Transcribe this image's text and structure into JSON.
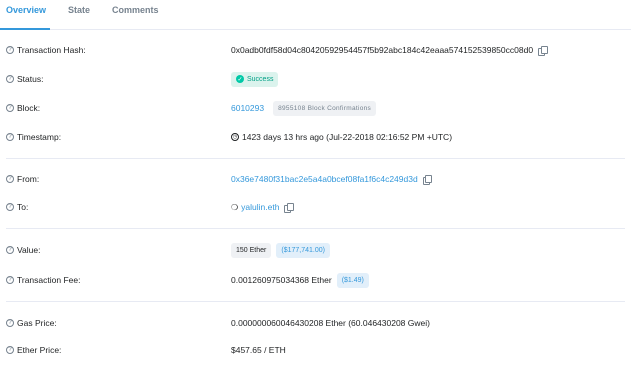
{
  "tabs": [
    {
      "label": "Overview"
    },
    {
      "label": "State"
    },
    {
      "label": "Comments"
    }
  ],
  "help_icon": "?",
  "rows": {
    "hash": {
      "label": "Transaction Hash:",
      "value": "0x0adb0fdf58d04c80420592954457f5b92abc184c42eaaa574152539850cc08d0"
    },
    "status": {
      "label": "Status:",
      "value": "Success",
      "color": "#00c9a7"
    },
    "block": {
      "label": "Block:",
      "value": "6010293",
      "confirmations": "8955108 Block Confirmations"
    },
    "timestamp": {
      "label": "Timestamp:",
      "value": "1423 days 13 hrs ago (Jul-22-2018 02:16:52 PM +UTC)"
    },
    "from": {
      "label": "From:",
      "value": "0x36e7480f31bac2e5a4a0bcef08fa1f6c4c249d3d"
    },
    "to": {
      "label": "To:",
      "value": "yalulin.eth"
    },
    "value": {
      "label": "Value:",
      "ether": "150 Ether",
      "usd": "($177,741.00)"
    },
    "fee": {
      "label": "Transaction Fee:",
      "value": "0.001260975034368 Ether",
      "usd": "($1.49)"
    },
    "gas_price": {
      "label": "Gas Price:",
      "value": "0.000000060046430208 Ether (60.046430208 Gwei)"
    },
    "ether_price": {
      "label": "Ether Price:",
      "value": "$457.65 / ETH"
    }
  },
  "accent_color": "#3498db"
}
